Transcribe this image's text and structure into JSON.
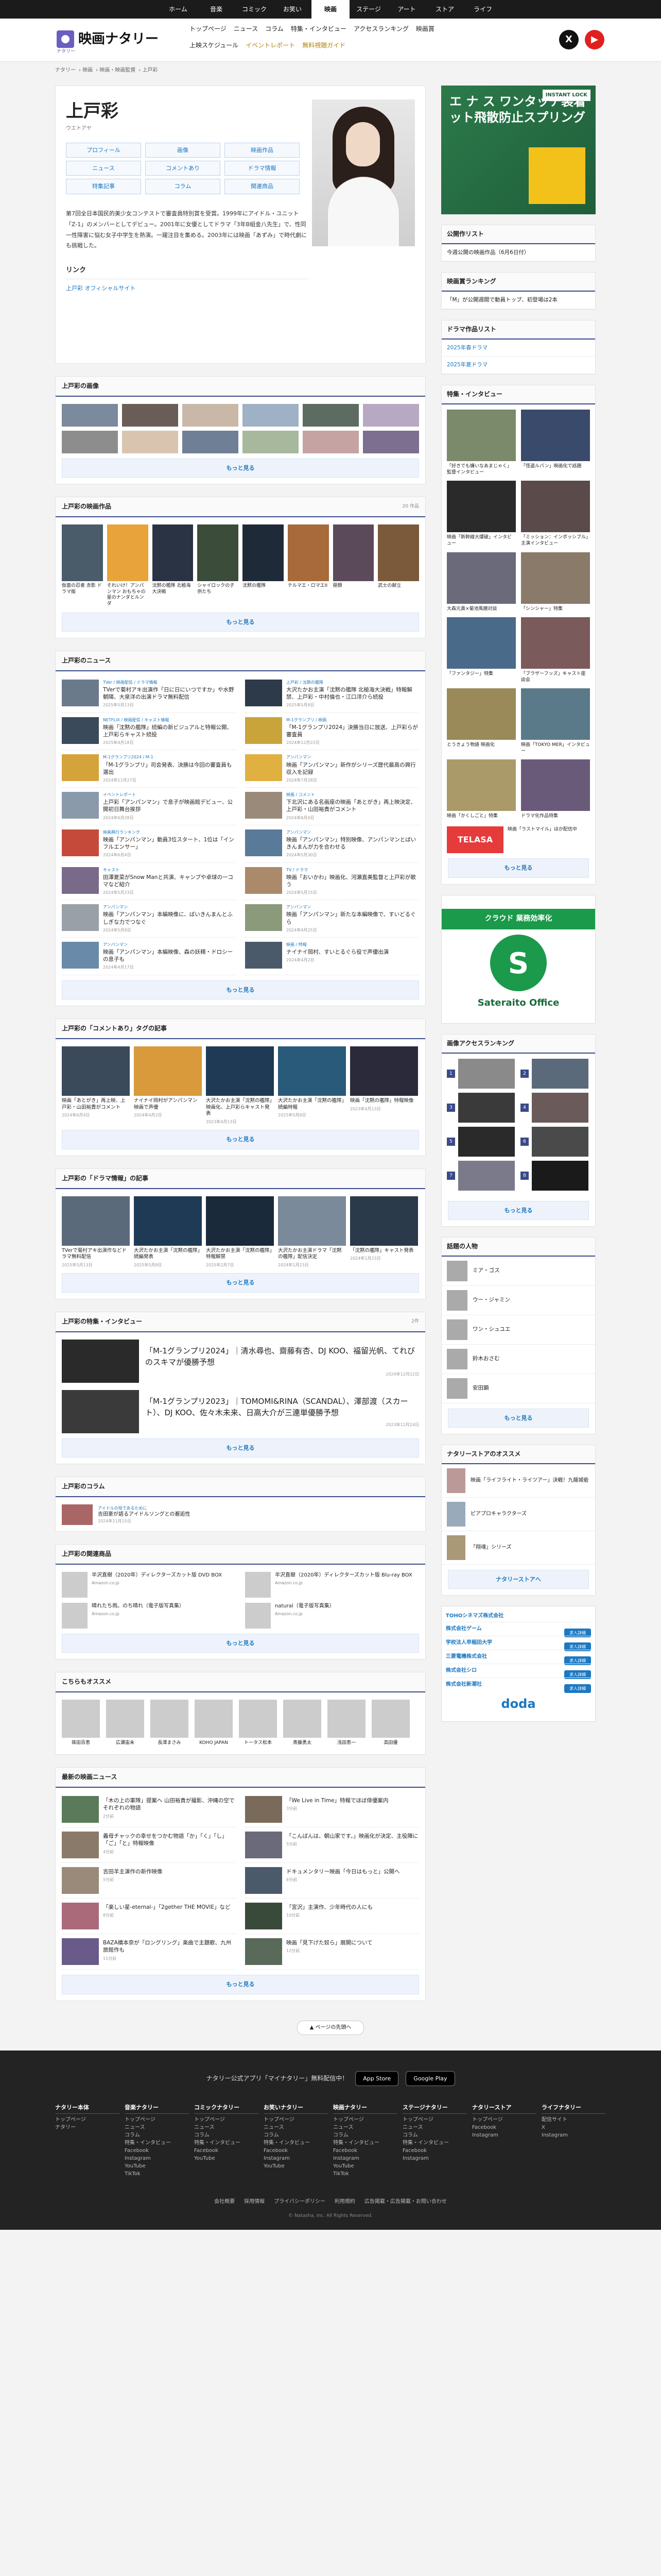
{
  "nav": {
    "categories": [
      "ホーム",
      "音楽",
      "コミック",
      "お笑い",
      "映画",
      "ステージ",
      "アート",
      "ストア",
      "ライフ"
    ],
    "active_index": 4
  },
  "header": {
    "logo_text": "映画ナタリー",
    "logo_sub": "ナタリー",
    "nav_row1": [
      "トップページ",
      "ニュース",
      "コラム",
      "特集・インタビュー",
      "アクセスランキング",
      "映画賞"
    ],
    "nav_row2": [
      "上映スケジュール",
      "イベントレポート",
      "無料視聴ガイド"
    ],
    "social": {
      "x": "X",
      "youtube": "▶"
    }
  },
  "breadcrumb": [
    "ナタリー",
    "映画",
    "映画・映画監督",
    "上戸彩"
  ],
  "profile": {
    "name": "上戸彩",
    "ruby": "ウエトアヤ",
    "nav_buttons": [
      "プロフィール",
      "画像",
      "映画作品",
      "ニュース",
      "コメントあり",
      "ドラマ情報",
      "特集記事",
      "コラム",
      "関連商品"
    ],
    "bio": "第7回全日本国民的美少女コンテストで審査員特別賞を受賞。1999年にアイドル・ユニット「Z-1」のメンバーとしてデビュー。2001年に女優としてドラマ「3年B組金八先生」で、性同一性障害に悩む女子中学生を熱演。一躍注目を集める。2003年には映画「あずみ」で時代劇にも挑戦した。",
    "links_title": "リンク",
    "link": "上戸彩 オフィシャルサイト"
  },
  "images": {
    "title": "上戸彩の画像",
    "more": "もっと見る"
  },
  "films": {
    "title": "上戸彩の映画作品",
    "count": "20 作品",
    "items": [
      "仮面の忍者 赤影 ドラマ版",
      "それいけ！アンパンマン おもちゃの星のナンダとルンダ",
      "沈黙の艦隊 北極海大決戦",
      "シャイロックの子供たち",
      "沈黙の艦隊",
      "テルマエ・ロマエII",
      "昼顔",
      "武士の献立"
    ],
    "more": "もっと見る"
  },
  "news": {
    "title": "上戸彩のニュース",
    "items": [
      {
        "tag": "TVer / 映画配信 / ドラマ情報",
        "title": "TVerで菊村アキ出演作「日に日にいつですか」や水野朝陽、大泉洋の出演ドラマ無料配信",
        "date": "2025年5月13日"
      },
      {
        "tag": "上戸彩 / 沈黙の艦隊",
        "title": "大沢たかお主演「沈黙の艦隊 北極海大決戦」特報解禁、上戸彩・中村倫也・江口洋介ら続投",
        "date": "2025年5月8日"
      },
      {
        "tag": "NETFLIX / 映画配信 / キャスト情報",
        "title": "映画「沈黙の艦隊」続編の新ビジュアルと特報公開、上戸彩らキャスト続投",
        "date": "2025年4月18日"
      },
      {
        "tag": "M-1グランプリ / 映画",
        "title": "「M-1グランプリ2024」決勝当日に放送、上戸彩らが審査員",
        "date": "2024年12月22日"
      },
      {
        "tag": "M-1グランプリ2024 / M-1",
        "title": "「M-1グランプリ」司会発表、決勝は今回の審査員も選出",
        "date": "2024年11月27日"
      },
      {
        "tag": "アンパンマン",
        "title": "映画「アンパンマン」新作がシリーズ歴代最高の興行収入を記録",
        "date": "2024年7月28日"
      },
      {
        "tag": "イベントレポート",
        "title": "上戸彩「アンパンマン」で息子が映画館デビュー、公開初日舞台挨拶",
        "date": "2024年6月28日"
      },
      {
        "tag": "映画 / コメント",
        "title": "下北沢にある名画座の映画「あとがき」再上映決定、上戸彩・山田裕貴がコメント",
        "date": "2024年6月4日"
      },
      {
        "tag": "映画興行ランキング",
        "title": "映画「アンパンマン」動員3位スタート、1位は「インフルエンサー」",
        "date": "2024年6月4日"
      },
      {
        "tag": "アンパンマン",
        "title": "映画「アンパンマン」特別映像、アンパンマンとばいきんまんが力を合わせる",
        "date": "2024年5月30日"
      },
      {
        "tag": "キャスト",
        "title": "田澤夏菜がSnow Manと共演、キャンプや卓球の一コマなど紹介",
        "date": "2024年5月23日"
      },
      {
        "tag": "TV / ドラマ",
        "title": "映画「おいかわ」映画化、河瀬直美監督と上戸彩が歌う",
        "date": "2024年5月15日"
      },
      {
        "tag": "アンパンマン",
        "title": "映画「アンパンマン」本編映像に、ばいきんまんとふしぎな力でつなぐ",
        "date": "2024年5月8日"
      },
      {
        "tag": "アンパンマン",
        "title": "映画「アンパンマン」新たな本編映像で、すいどるぐら",
        "date": "2024年4月25日"
      },
      {
        "tag": "アンパンマン",
        "title": "映画「アンパンマン」本編映像、森の妖精・ドロシーの息子も",
        "date": "2024年4月17日"
      },
      {
        "tag": "映画 / 特報",
        "title": "ナイナイ岡村、すいとるぐら役で声優出演",
        "date": "2024年4月2日"
      }
    ],
    "more": "もっと見る"
  },
  "comment_articles": {
    "title": "上戸彩の「コメントあり」タグの記事",
    "items": [
      {
        "title": "映画「あとがき」再上映、上戸彩・山田裕貴がコメント",
        "date": "2024年6月4日"
      },
      {
        "title": "ナイナイ岡村がアンパンマン映画で声優",
        "date": "2024年4月2日"
      },
      {
        "title": "大沢たかお主演「沈黙の艦隊」映画化、上戸彩らキャスト発表",
        "date": "2023年4月13日"
      },
      {
        "title": "大沢たかお主演「沈黙の艦隊」続編特報",
        "date": "2025年5月8日"
      },
      {
        "title": "映画「沈黙の艦隊」特報映像",
        "date": "2023年4月13日"
      }
    ],
    "more": "もっと見る"
  },
  "drama_articles": {
    "title": "上戸彩の「ドラマ情報」の記事",
    "items": [
      {
        "title": "TVerで菊村アキ出演作などドラマ無料配信",
        "date": "2025年5月13日"
      },
      {
        "title": "大沢たかお主演「沈黙の艦隊」続編発表",
        "date": "2025年5月8日"
      },
      {
        "title": "大沢たかお主演「沈黙の艦隊」特報解禁",
        "date": "2025年2月7日"
      },
      {
        "title": "大沢たかお主演ドラマ「沈黙の艦隊」配信決定",
        "date": "2024年1月23日"
      },
      {
        "title": "「沈黙の艦隊」キャスト発表",
        "date": "2024年1月23日"
      }
    ],
    "more": "もっと見る"
  },
  "features": {
    "title": "上戸彩の特集・インタビュー",
    "count": "2件",
    "items": [
      {
        "title": "「M-1グランプリ2024」｜清水尋也、齋藤有杏、DJ KOO、福留光帆、てれびのスキマが優勝予想",
        "date": "2024年12月22日"
      },
      {
        "title": "「M-1グランプリ2023」｜TOMOMI&RINA（SCANDAL）、澤部渡（スカート）、DJ KOO、佐々木未来、日高大介が三連単優勝予想",
        "date": "2023年12月24日"
      }
    ],
    "more": "もっと見る"
  },
  "columns": {
    "title": "上戸彩のコラム",
    "tag": "アイドルの母であるために",
    "text": "吉田豪が語るアイドルソングとの邂逅性",
    "date": "2024年11月15日"
  },
  "products": {
    "title": "上戸彩の関連商品",
    "items": [
      {
        "title": "半沢直樹（2020年）ディレクターズカット版 DVD BOX",
        "badge": "Amazon.co.jp"
      },
      {
        "title": "半沢直樹（2020年）ディレクターズカット版 Blu-ray BOX",
        "badge": "Amazon.co.jp"
      },
      {
        "title": "晴れたち雨。のち晴れ（電子版写真集）",
        "badge": "Amazon.co.jp"
      },
      {
        "title": "natural（電子版写真集）",
        "badge": "Amazon.co.jp"
      }
    ],
    "more": "もっと見る"
  },
  "recommend": {
    "title": "こちらもオススメ",
    "items": [
      "篠田百恵",
      "広瀬宙未",
      "長澤まさみ",
      "KOHO JAPAN",
      "トータス松本",
      "斎藤勇太",
      "浅田恵一",
      "高田優"
    ]
  },
  "latest": {
    "title": "最新の映画ニュース",
    "items": [
      {
        "title": "「木の上の軍隊」提案へ 山田裕貴が撮影、沖縄の空でそれぞれの物語",
        "date": "2分前"
      },
      {
        "title": "「We Live in Time」特報でほぼ俳優案内",
        "date": "3分前"
      },
      {
        "title": "義母チャックの幸せをつかむ物語「か」「く」「し」「ご」「と」特報映像",
        "date": "4分前"
      },
      {
        "title": "「こんばんは、朝山家です。」映画化が決定、主役陣に",
        "date": "5分前"
      },
      {
        "title": "吉田羊主演作の新作映像",
        "date": "5分前"
      },
      {
        "title": "ドキュメンタリー映画「今日はもっと」公開へ",
        "date": "6分前"
      },
      {
        "title": "「楽しい星-eternal-」「2gether THE MOVIE」など",
        "date": "8分前"
      },
      {
        "title": "「宮沢」主演作、少年時代の人にも",
        "date": "10分前"
      },
      {
        "title": "BAZA橋本奈が「ロングリング」楽曲で主題歌、九州旅館作も",
        "date": "11分前"
      },
      {
        "title": "映画「見下げた奴ら」展開について",
        "date": "12分前"
      }
    ],
    "more": "もっと見る"
  },
  "to_top": "▲ ページの先頭へ",
  "sidebar": {
    "ad1": {
      "label": "INSTANT LOCK",
      "headline": "エ ナ ス ワンタッチ装着 ット飛散防止スプリング"
    },
    "public_list": {
      "title": "公開作リスト",
      "items": [
        "今週公開の映画作品（6月6日付）"
      ]
    },
    "award_ranking": {
      "title": "映画賞ランキング",
      "items": [
        "「M」が公開週間で動員トップ、初登場は2本"
      ]
    },
    "drama_list": {
      "title": "ドラマ作品リスト",
      "items": [
        "2025年春ドラマ",
        "2025年夏ドラマ"
      ]
    },
    "features": {
      "title": "特集・インタビュー",
      "items": [
        "「好きでも嫌いなあまじゃく」監督インタビュー",
        "「怪盗ルパン」映画化で話題",
        "映画「新幹線大爆破」インタビュー",
        "「ミッション：インポッシブル」主演インタビュー",
        "大森元貴×菊池風磨対談",
        "「シンシャー」特集",
        "「ファンタジー」特集",
        "「ブラザーフッズ」キャスト座談会",
        "とうきょう物語 映画化",
        "映画「TOKYO MER」インタビュー",
        "映画「かくしごと」特集",
        "ドラマ化作品特集"
      ],
      "telasa": "TELASA",
      "telasa_text": "映画「ラストマイル」ほか配信中",
      "more": "もっと見る"
    },
    "ad2": {
      "headline": "クラウド 業務効率化",
      "name": "Sateraito Office"
    },
    "ranking": {
      "title": "画像アクセスランキング",
      "more": "もっと見る"
    },
    "people": {
      "title": "話題の人物",
      "items": [
        "ミア・ゴス",
        "ウー・ジャミン",
        "ワン・シュユエ",
        "鈴木おさむ",
        "安田顕"
      ],
      "more": "もっと見る"
    },
    "store": {
      "title": "ナタリーストアのオススメ",
      "items": [
        "映画「ライフライト・ライツアー」決戦！九龍城砦",
        "ピアプロキャラクターズ",
        "「翔魂」シリーズ"
      ],
      "more": "ナタリーストアへ"
    },
    "jobs": {
      "head": "TOHOシネマズ株式会社",
      "items": [
        "株式会社ゲーム",
        "学校法人早稲田大学",
        "三菱電機株式会社",
        "株式会社シロ",
        "株式会社新潮社"
      ],
      "apply": "求人詳細",
      "brand": "doda"
    }
  },
  "footer": {
    "app_text": "ナタリー公式アプリ「マイナタリー」無料配信中！",
    "app_store": "App Store",
    "google_play": "Google Play",
    "cols": [
      {
        "head": "ナタリー本体",
        "links": [
          "トップページ",
          "ナタリー"
        ]
      },
      {
        "head": "音楽ナタリー",
        "links": [
          "トップページ",
          "ニュース",
          "コラム",
          "特集・インタビュー",
          "Facebook",
          "Instagram",
          "YouTube",
          "TikTok"
        ]
      },
      {
        "head": "コミックナタリー",
        "links": [
          "トップページ",
          "ニュース",
          "コラム",
          "特集・インタビュー",
          "Facebook",
          "YouTube"
        ]
      },
      {
        "head": "お笑いナタリー",
        "links": [
          "トップページ",
          "ニュース",
          "コラム",
          "特集・インタビュー",
          "Facebook",
          "Instagram",
          "YouTube"
        ]
      },
      {
        "head": "映画ナタリー",
        "links": [
          "トップページ",
          "ニュース",
          "コラム",
          "特集・インタビュー",
          "Facebook",
          "Instagram",
          "YouTube",
          "TikTok"
        ]
      },
      {
        "head": "ステージナタリー",
        "links": [
          "トップページ",
          "ニュース",
          "コラム",
          "特集・インタビュー",
          "Facebook",
          "Instagram"
        ]
      },
      {
        "head": "ナタリーストア",
        "links": [
          "トップページ",
          "Facebook",
          "Instagram"
        ]
      },
      {
        "head": "ライフナタリー",
        "links": [
          "配信サイト",
          "X",
          "Instagram"
        ]
      }
    ],
    "links": [
      "会社概要",
      "採用情報",
      "プライバシーポリシー",
      "利用規約",
      "広告掲載・広告掲載・お問い合わせ"
    ],
    "copyright": "© Natasha, Inc. All Rights Reserved."
  }
}
